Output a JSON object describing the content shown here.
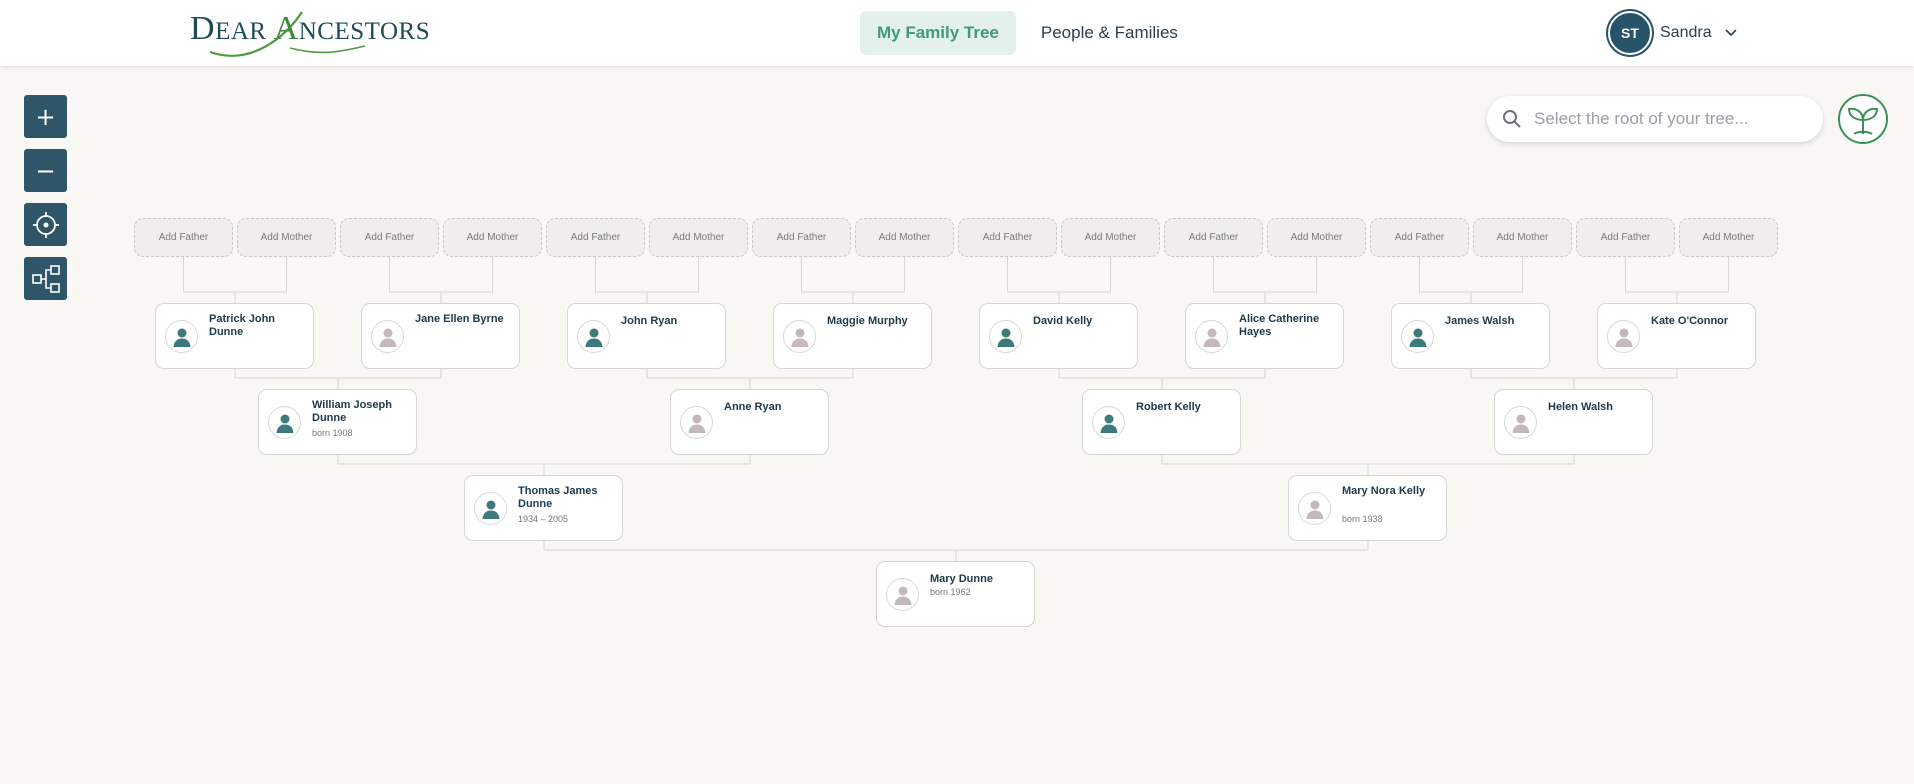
{
  "app": {
    "logo_text": "DEAR ANCESTORS",
    "logo_parts": {
      "d": "D",
      "ear": "EAR",
      "a": "A",
      "ncestors": "NCESTORS"
    }
  },
  "nav": {
    "tabs": [
      {
        "label": "My Family Tree",
        "active": true
      },
      {
        "label": "People & Families",
        "active": false
      }
    ]
  },
  "user": {
    "initials": "ST",
    "name": "Sandra",
    "dropdown_icon": "chevron-down-icon"
  },
  "controls": [
    {
      "name": "zoom-in-button",
      "icon": "plus-icon",
      "glyph": "+"
    },
    {
      "name": "zoom-out-button",
      "icon": "minus-icon",
      "glyph": "−"
    },
    {
      "name": "center-button",
      "icon": "crosshair-icon"
    },
    {
      "name": "layout-button",
      "icon": "hierarchy-icon"
    }
  ],
  "search": {
    "placeholder": "Select the root of your tree...",
    "value": "",
    "icon": "search-icon"
  },
  "tree_button": {
    "icon": "sprout-icon"
  },
  "add_labels": {
    "father": "Add Father",
    "mother": "Add Mother"
  },
  "colors": {
    "accent": "#3f9a7c",
    "control_bg": "#2f5568",
    "male_icon": "#3c7a7b",
    "female_icon": "#c5b7be",
    "sprout": "#3e8e5a"
  },
  "people": {
    "patrick": {
      "name": "Patrick John Dunne",
      "dates": "",
      "gender": "male"
    },
    "jane": {
      "name": "Jane Ellen Byrne",
      "dates": "",
      "gender": "female"
    },
    "john": {
      "name": "John Ryan",
      "dates": "",
      "gender": "male"
    },
    "maggie": {
      "name": "Maggie Murphy",
      "dates": "",
      "gender": "female"
    },
    "david": {
      "name": "David Kelly",
      "dates": "",
      "gender": "male"
    },
    "alice": {
      "name": "Alice Catherine Hayes",
      "dates": "",
      "gender": "female"
    },
    "james": {
      "name": "James Walsh",
      "dates": "",
      "gender": "male"
    },
    "kate": {
      "name": "Kate O'Connor",
      "dates": "",
      "gender": "female"
    },
    "william": {
      "name": "William Joseph Dunne",
      "dates": "born 1908",
      "gender": "male"
    },
    "anne": {
      "name": "Anne Ryan",
      "dates": "",
      "gender": "female"
    },
    "robert": {
      "name": "Robert Kelly",
      "dates": "",
      "gender": "male"
    },
    "helen": {
      "name": "Helen Walsh",
      "dates": "",
      "gender": "female"
    },
    "thomas": {
      "name": "Thomas James Dunne",
      "dates": "1934 – 2005",
      "gender": "male"
    },
    "marynora": {
      "name": "Mary Nora Kelly",
      "dates": "born 1938",
      "gender": "female"
    },
    "mary": {
      "name": "Mary Dunne",
      "dates": "born 1962",
      "gender": "female"
    }
  }
}
